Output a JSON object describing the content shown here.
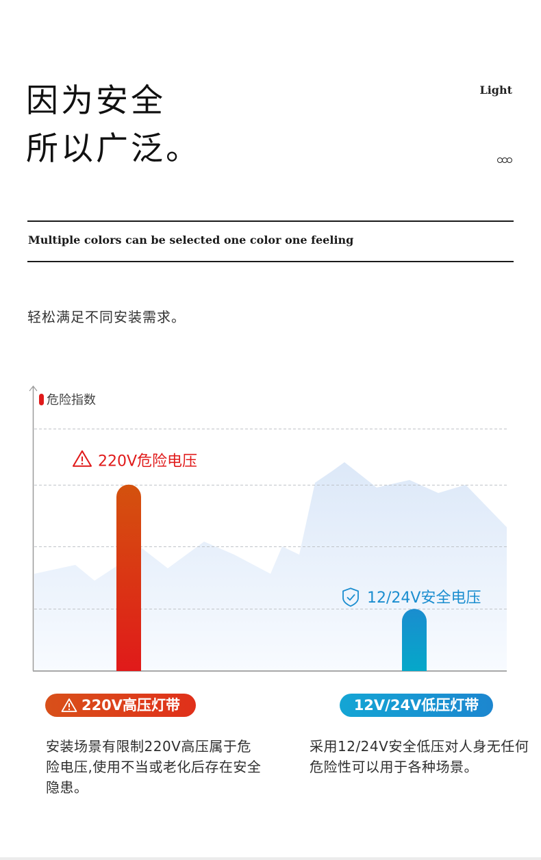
{
  "header": {
    "title_line1": "因为安全",
    "title_line2": "所以广泛。",
    "brand_word": "Light",
    "dots_icon": "three-circles-icon"
  },
  "tagline": "Multiple colors can be selected one color one feeling",
  "subtitle": "轻松满足不同安装需求。",
  "colors": {
    "danger": "#e01a1a",
    "danger_top": "#d4520e",
    "safe": "#1a8dcf",
    "safe_bottom": "#05a8c9",
    "mountain": "#dde9f8",
    "grid": "#bfc3c8",
    "axis": "#999999"
  },
  "chart_data": {
    "type": "bar",
    "title": "危险指数",
    "xlabel": "",
    "ylabel": "危险指数",
    "ylim": [
      0,
      3.9
    ],
    "grid": true,
    "gridlines": [
      1,
      2,
      3,
      3.9
    ],
    "categories": [
      "220V高压灯带",
      "12V/24V低压灯带"
    ],
    "values": [
      3.0,
      1.0
    ],
    "bar_labels": [
      "220V危险电压",
      "12/24V安全电压"
    ],
    "bar_icons": [
      "warning-triangle-icon",
      "shield-check-icon"
    ],
    "legend": "top-left",
    "background": "mountain silhouette"
  },
  "cards": [
    {
      "badge": "220V高压灯带",
      "badge_icon": "warning-triangle-icon",
      "description": "安装场景有限制220V高压属于危险电压,使用不当或老化后存在安全隐患。"
    },
    {
      "badge": "12V/24V低压灯带",
      "description": "采用12/24V安全低压对人身无任何危险性可以用于各种场景。"
    }
  ]
}
